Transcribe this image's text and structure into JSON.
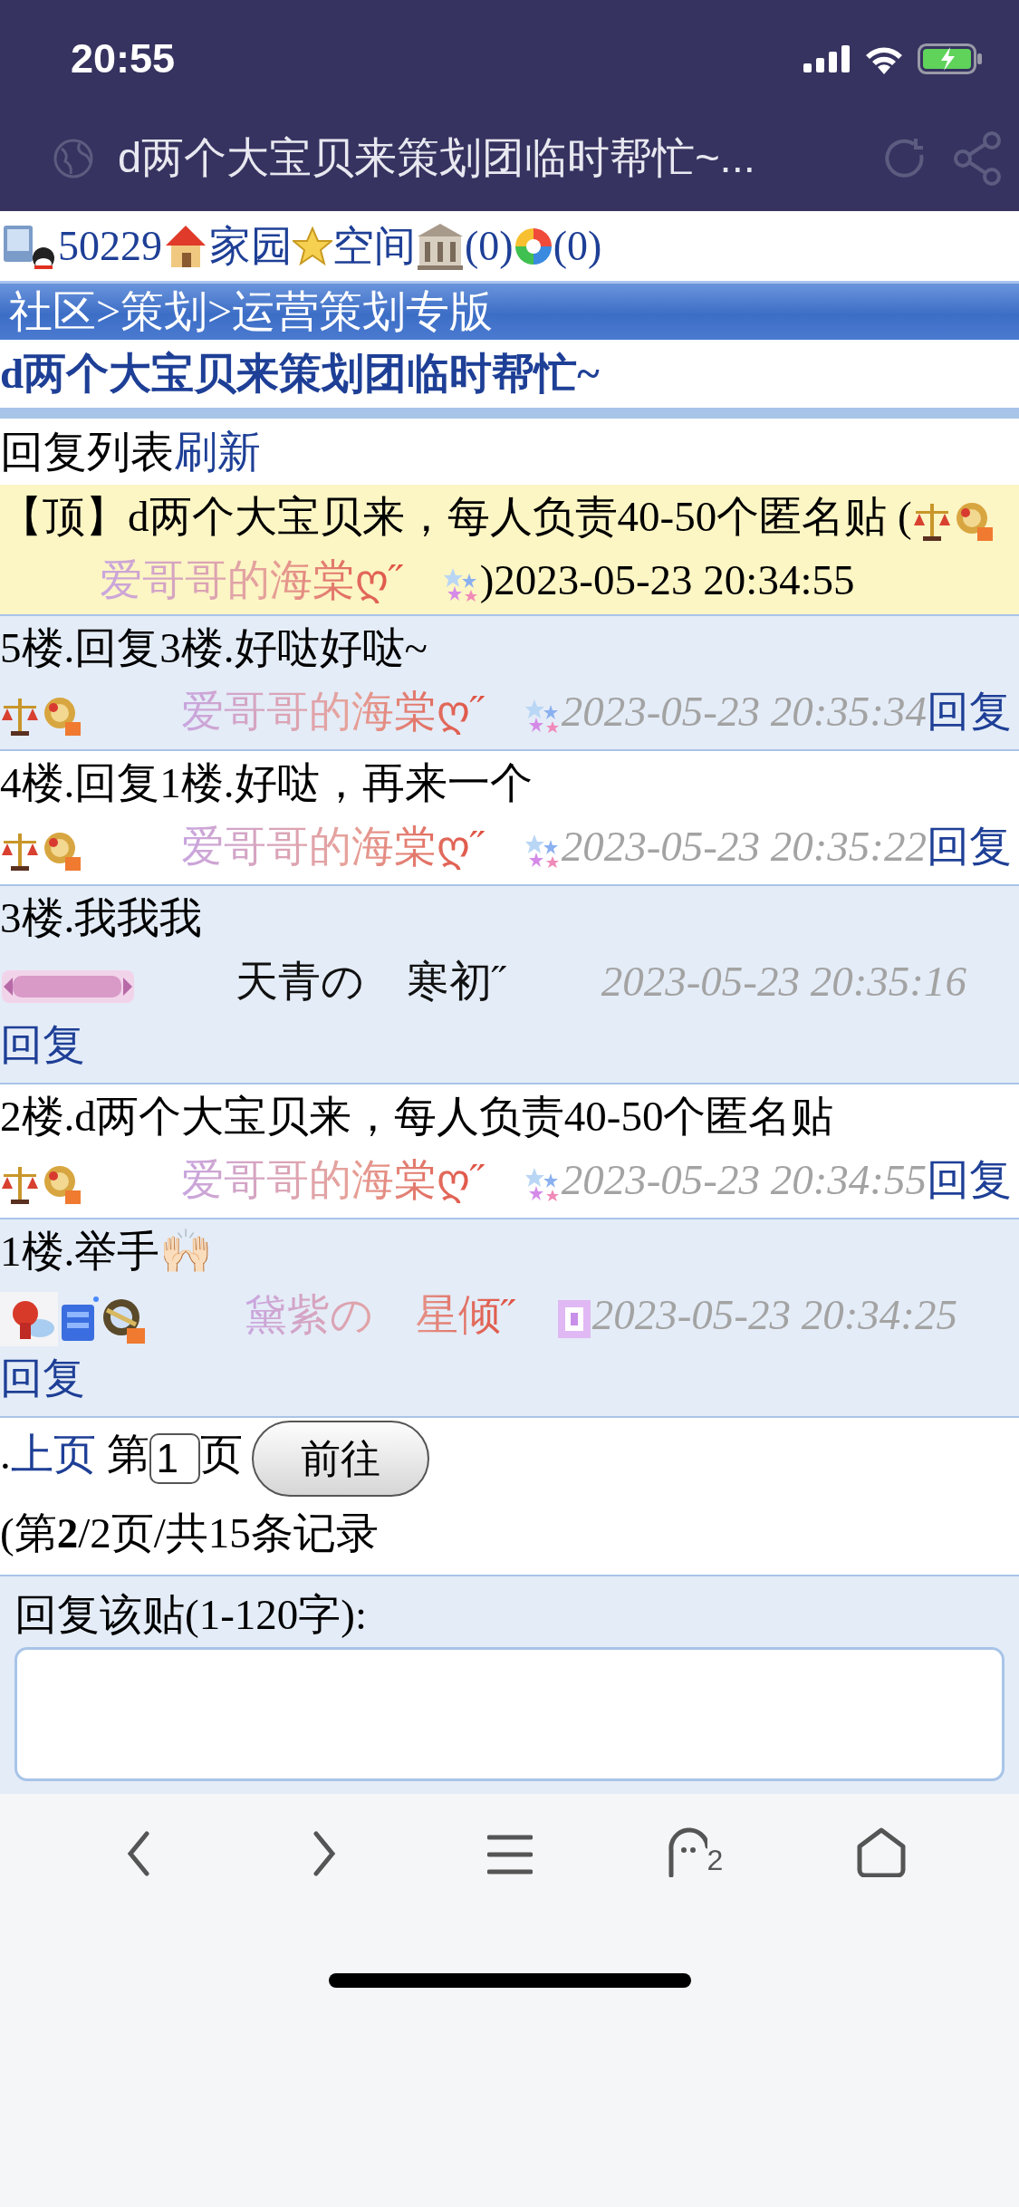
{
  "status_bar": {
    "time": "20:55"
  },
  "browser_bar": {
    "title": "d两个大宝贝来策划团临时帮忙~..."
  },
  "top_links": [
    {
      "text": "50229"
    },
    {
      "text": "家园"
    },
    {
      "text": "空间"
    },
    {
      "text": "(0)"
    },
    {
      "text": "(0)"
    }
  ],
  "breadcrumb": "社区>策划>运营策划专版",
  "thread_title": "d两个大宝贝来策划团临时帮忙~",
  "list_header": {
    "label": "回复列表",
    "refresh": "刷新"
  },
  "pinned": {
    "text": "【顶】d两个大宝贝来，每人负责40-50个匿名贴 (",
    "author": "爱哥哥的海棠ღ˝",
    "time": ")2023-05-23 20:34:55"
  },
  "posts": [
    {
      "kind": "medals",
      "text": "5楼.回复3楼.好哒好哒~",
      "author": "爱哥哥的海棠ღ˝",
      "colored_name": true,
      "time": "2023-05-23 20:35:34",
      "reply": "回复"
    },
    {
      "kind": "medals",
      "text": "4楼.回复1楼.好哒，再来一个",
      "author": "爱哥哥的海棠ღ˝",
      "colored_name": true,
      "time": "2023-05-23 20:35:22",
      "reply": "回复"
    },
    {
      "kind": "badge",
      "text": "3楼.我我我",
      "author": "天青の　寒初˝",
      "colored_name": false,
      "time": "2023-05-23 20:35:16",
      "reply": "回复"
    },
    {
      "kind": "medals",
      "text": "2楼.d两个大宝贝来，每人负责40-50个匿名贴",
      "author": "爱哥哥的海棠ღ˝",
      "colored_name": true,
      "time": "2023-05-23 20:34:55",
      "reply": "回复"
    },
    {
      "kind": "fairy",
      "text": "1楼.举手🙌🏻",
      "author": "黛紫の　星倾˝",
      "colored_name": true,
      "time": "2023-05-23 20:34:25",
      "reply": "回复"
    }
  ],
  "pager": {
    "lead": ".",
    "prev": "上页",
    "before": "第",
    "page": "1",
    "after": "页",
    "go": "前往",
    "summary": "(第**2**/2页/共15条记录"
  },
  "reply_box": {
    "label": "回复该贴(1-120字):"
  },
  "toolbar": {
    "tab_count": "2"
  }
}
